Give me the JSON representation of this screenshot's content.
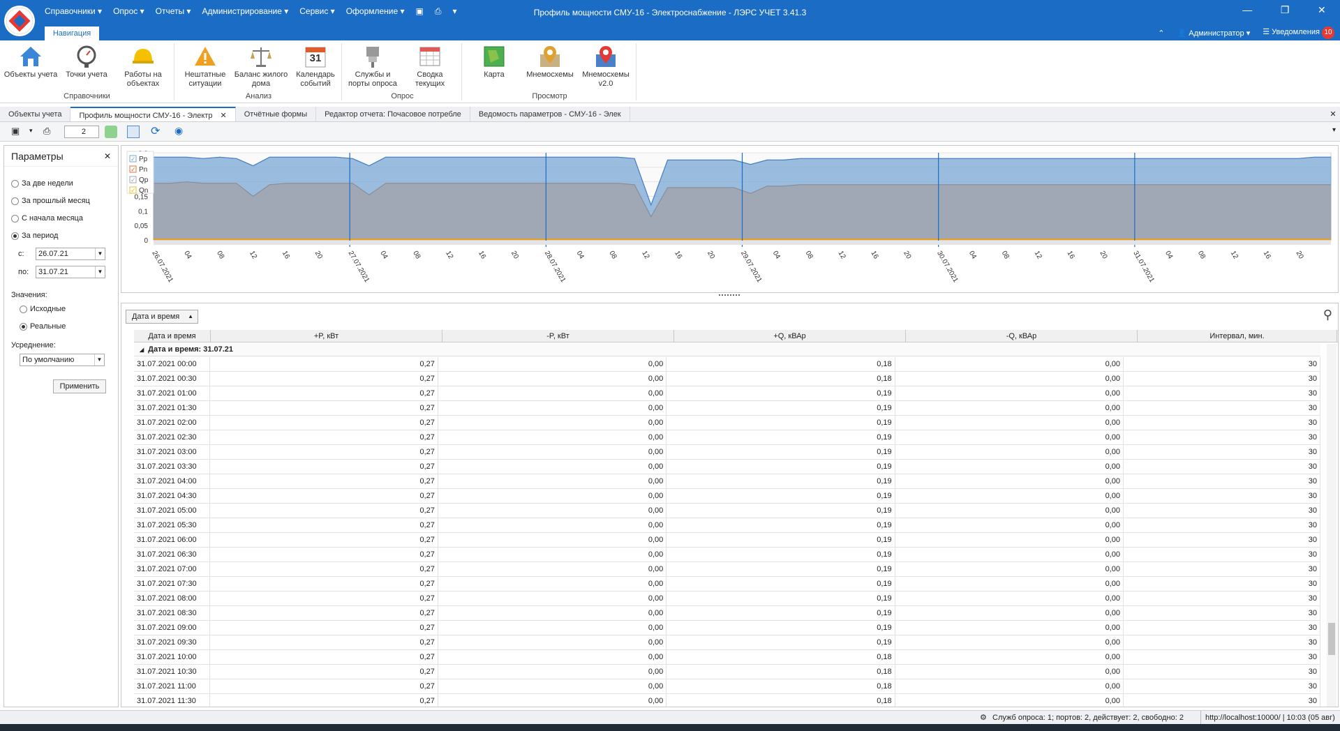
{
  "window": {
    "title": "Профиль мощности СМУ-16 - Электроснабжение - ЛЭРС УЧЕТ 3.41.3",
    "menu": [
      "Справочники ▾",
      "Опрос ▾",
      "Отчеты ▾",
      "Администрирование ▾",
      "Сервис ▾",
      "Оформление ▾"
    ],
    "nav_tab": "Навигация",
    "user": "Администратор ▾",
    "notifications": "Уведомления",
    "notifications_count": "10"
  },
  "ribbon": {
    "groups": [
      {
        "label": "Справочники",
        "buttons": [
          "Объекты учета",
          "Точки учета",
          "Работы на объектах"
        ]
      },
      {
        "label": "Анализ",
        "buttons": [
          "Нештатные ситуации",
          "Баланс жилого дома",
          "Календарь событий"
        ]
      },
      {
        "label": "Опрос",
        "buttons": [
          "Службы и порты опроса",
          "Сводка текущих"
        ]
      },
      {
        "label": "Просмотр",
        "buttons": [
          "Карта",
          "Мнемосхемы",
          "Мнемосхемы v2.0"
        ]
      }
    ],
    "calendar_day": "31"
  },
  "doc_tabs": [
    "Объекты учета",
    "Профиль мощности СМУ-16 - Электр",
    "Отчётные формы",
    "Редактор отчета: Почасовое потребле",
    "Ведомость параметров - СМУ-16 - Элек"
  ],
  "toolbar": {
    "counter": "2"
  },
  "params": {
    "title": "Параметры",
    "periods": [
      "За две недели",
      "За прошлый месяц",
      "С начала месяца",
      "За период"
    ],
    "from_label": "с:",
    "from_value": "26.07.21",
    "to_label": "по:",
    "to_value": "31.07.21",
    "values_label": "Значения:",
    "values": [
      "Исходные",
      "Реальные"
    ],
    "avg_label": "Усреднение:",
    "avg_value": "По умолчанию",
    "apply": "Применить"
  },
  "chart_data": {
    "type": "area",
    "legend": [
      "Pp",
      "Pn",
      "Qp",
      "Qn"
    ],
    "y_ticks": [
      "0,3",
      "0,25",
      "0,2",
      "0,15",
      "0,1",
      "0,05",
      "0"
    ],
    "ylim": [
      0,
      0.3
    ],
    "dates": [
      "26.07.2021",
      "27.07.2021",
      "28.07.2021",
      "29.07.2021",
      "30.07.2021",
      "31.07.2021"
    ],
    "hour_ticks": [
      "04",
      "08",
      "12",
      "16",
      "20"
    ],
    "series": [
      {
        "name": "Pp",
        "color": "#7aa7d6",
        "values": [
          0.285,
          0.285,
          0.285,
          0.28,
          0.285,
          0.28,
          0.255,
          0.285,
          0.285,
          0.285,
          0.285,
          0.285,
          0.28,
          0.255,
          0.285,
          0.285,
          0.285,
          0.285,
          0.285,
          0.285,
          0.285,
          0.285,
          0.285,
          0.285,
          0.285,
          0.285,
          0.285,
          0.285,
          0.285,
          0.28,
          0.12,
          0.275,
          0.275,
          0.275,
          0.275,
          0.275,
          0.26,
          0.275,
          0.275,
          0.28,
          0.28,
          0.28,
          0.28,
          0.28,
          0.28,
          0.28,
          0.28,
          0.28,
          0.28,
          0.28,
          0.28,
          0.28,
          0.28,
          0.28,
          0.28,
          0.28,
          0.28,
          0.28,
          0.28,
          0.28,
          0.28,
          0.28,
          0.28,
          0.28,
          0.28,
          0.28,
          0.28,
          0.28,
          0.28,
          0.28,
          0.285,
          0.285
        ]
      },
      {
        "name": "Qp",
        "color": "#a0a4ad",
        "values": [
          0.195,
          0.195,
          0.2,
          0.195,
          0.195,
          0.195,
          0.15,
          0.19,
          0.195,
          0.195,
          0.195,
          0.195,
          0.195,
          0.155,
          0.195,
          0.195,
          0.195,
          0.195,
          0.195,
          0.195,
          0.195,
          0.195,
          0.195,
          0.195,
          0.195,
          0.195,
          0.195,
          0.195,
          0.195,
          0.19,
          0.08,
          0.18,
          0.18,
          0.18,
          0.18,
          0.18,
          0.16,
          0.185,
          0.185,
          0.19,
          0.19,
          0.19,
          0.19,
          0.19,
          0.19,
          0.19,
          0.19,
          0.19,
          0.19,
          0.19,
          0.19,
          0.19,
          0.19,
          0.19,
          0.19,
          0.19,
          0.19,
          0.19,
          0.19,
          0.19,
          0.19,
          0.19,
          0.19,
          0.19,
          0.19,
          0.19,
          0.19,
          0.19,
          0.19,
          0.19,
          0.19,
          0.19
        ]
      }
    ]
  },
  "grid": {
    "group_button": "Дата и время",
    "columns": [
      "Дата и время",
      "+P, кВт",
      "-P, кВт",
      "+Q, кВАр",
      "-Q, кВАр",
      "Интервал, мин."
    ],
    "group_label": "Дата и время: 31.07.21",
    "rows": [
      [
        "31.07.2021 00:00",
        "0,27",
        "0,00",
        "0,18",
        "0,00",
        "30"
      ],
      [
        "31.07.2021 00:30",
        "0,27",
        "0,00",
        "0,18",
        "0,00",
        "30"
      ],
      [
        "31.07.2021 01:00",
        "0,27",
        "0,00",
        "0,19",
        "0,00",
        "30"
      ],
      [
        "31.07.2021 01:30",
        "0,27",
        "0,00",
        "0,19",
        "0,00",
        "30"
      ],
      [
        "31.07.2021 02:00",
        "0,27",
        "0,00",
        "0,19",
        "0,00",
        "30"
      ],
      [
        "31.07.2021 02:30",
        "0,27",
        "0,00",
        "0,19",
        "0,00",
        "30"
      ],
      [
        "31.07.2021 03:00",
        "0,27",
        "0,00",
        "0,19",
        "0,00",
        "30"
      ],
      [
        "31.07.2021 03:30",
        "0,27",
        "0,00",
        "0,19",
        "0,00",
        "30"
      ],
      [
        "31.07.2021 04:00",
        "0,27",
        "0,00",
        "0,19",
        "0,00",
        "30"
      ],
      [
        "31.07.2021 04:30",
        "0,27",
        "0,00",
        "0,19",
        "0,00",
        "30"
      ],
      [
        "31.07.2021 05:00",
        "0,27",
        "0,00",
        "0,19",
        "0,00",
        "30"
      ],
      [
        "31.07.2021 05:30",
        "0,27",
        "0,00",
        "0,19",
        "0,00",
        "30"
      ],
      [
        "31.07.2021 06:00",
        "0,27",
        "0,00",
        "0,19",
        "0,00",
        "30"
      ],
      [
        "31.07.2021 06:30",
        "0,27",
        "0,00",
        "0,19",
        "0,00",
        "30"
      ],
      [
        "31.07.2021 07:00",
        "0,27",
        "0,00",
        "0,19",
        "0,00",
        "30"
      ],
      [
        "31.07.2021 07:30",
        "0,27",
        "0,00",
        "0,19",
        "0,00",
        "30"
      ],
      [
        "31.07.2021 08:00",
        "0,27",
        "0,00",
        "0,19",
        "0,00",
        "30"
      ],
      [
        "31.07.2021 08:30",
        "0,27",
        "0,00",
        "0,19",
        "0,00",
        "30"
      ],
      [
        "31.07.2021 09:00",
        "0,27",
        "0,00",
        "0,19",
        "0,00",
        "30"
      ],
      [
        "31.07.2021 09:30",
        "0,27",
        "0,00",
        "0,19",
        "0,00",
        "30"
      ],
      [
        "31.07.2021 10:00",
        "0,27",
        "0,00",
        "0,18",
        "0,00",
        "30"
      ],
      [
        "31.07.2021 10:30",
        "0,27",
        "0,00",
        "0,18",
        "0,00",
        "30"
      ],
      [
        "31.07.2021 11:00",
        "0,27",
        "0,00",
        "0,18",
        "0,00",
        "30"
      ],
      [
        "31.07.2021 11:30",
        "0,27",
        "0,00",
        "0,18",
        "0,00",
        "30"
      ]
    ]
  },
  "status": {
    "services": "Служб опроса: 1; портов: 2, действует: 2, свободно: 2",
    "server": "http://localhost:10000/ | 10:03 (05 авг)"
  }
}
